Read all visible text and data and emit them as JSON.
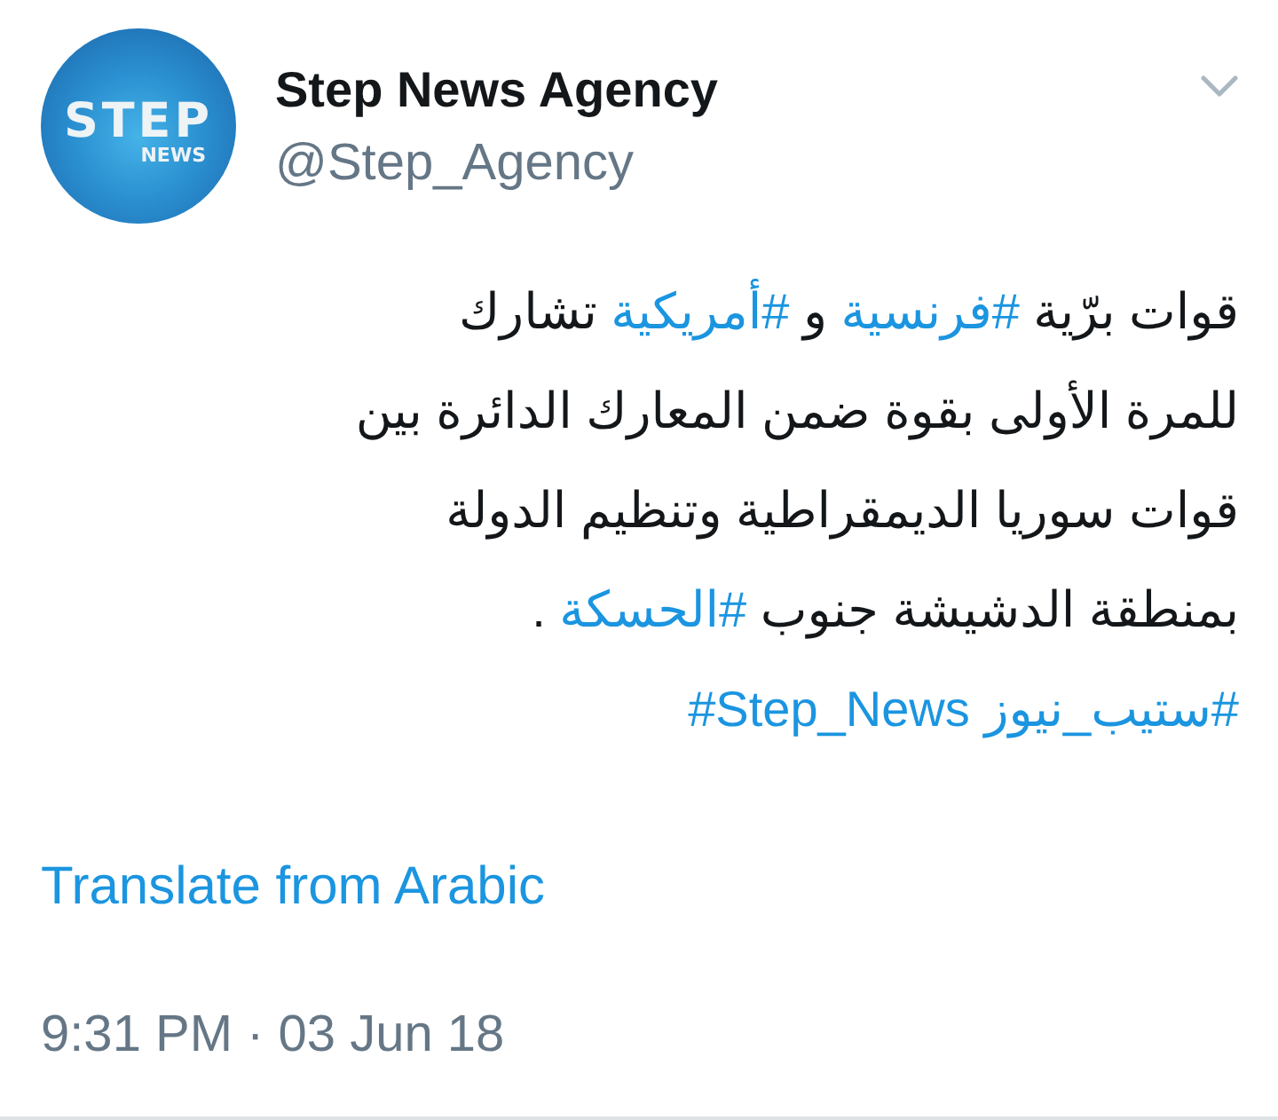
{
  "author": {
    "avatar": {
      "wordmark": "STEP",
      "subtitle": "NEWS"
    },
    "name": "Step News Agency",
    "handle": "@Step_Agency"
  },
  "tweet": {
    "lines": [
      [
        {
          "kind": "text",
          "text": "قوات برّية "
        },
        {
          "kind": "hashtag",
          "text": "#فرنسية"
        },
        {
          "kind": "text",
          "text": " و "
        },
        {
          "kind": "hashtag",
          "text": "#أمريكية"
        },
        {
          "kind": "text",
          "text": " تشارك"
        }
      ],
      [
        {
          "kind": "text",
          "text": "للمرة الأولى بقوة ضمن المعارك الدائرة بين"
        }
      ],
      [
        {
          "kind": "text",
          "text": "قوات سوريا الديمقراطية وتنظيم الدولة"
        }
      ],
      [
        {
          "kind": "text",
          "text": "بمنطقة الدشيشة جنوب "
        },
        {
          "kind": "hashtag",
          "text": "#الحسكة"
        },
        {
          "kind": "text",
          "text": " ."
        }
      ],
      [
        {
          "kind": "hashtag",
          "text": "#ستيب_نيوز"
        },
        {
          "kind": "hashtag",
          "text": "#Step_News"
        }
      ]
    ]
  },
  "translate_link": "Translate from Arabic",
  "timestamp": "9:31 PM · 03 Jun 18"
}
